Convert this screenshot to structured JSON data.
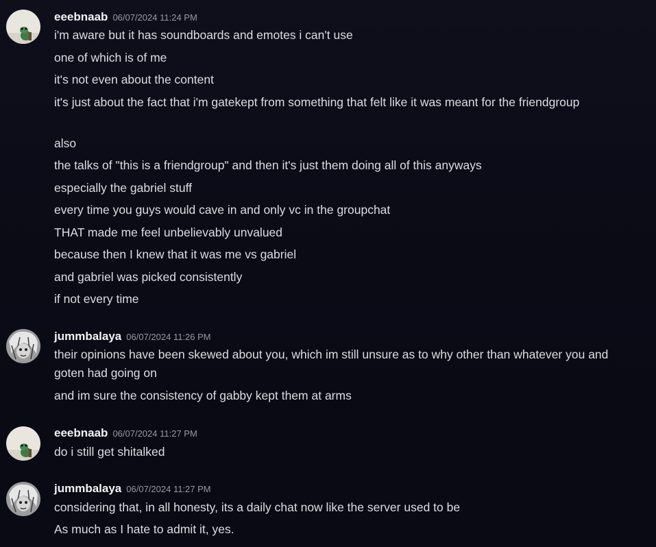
{
  "groups": [
    {
      "username": "eeebnaab",
      "timestamp": "06/07/2024 11:24 PM",
      "avatar_icon": "frog-avatar-icon",
      "messages": [
        "i'm aware but it has soundboards and emotes i can't use",
        "one of which is of me",
        "it's not even about the content",
        "it's just about the fact that i'm gatekept from something that felt like it was meant for the friendgroup",
        "also",
        "the talks of \"this is a friendgroup\" and then it's just them doing all of this anyways",
        "especially the gabriel stuff",
        "every time you guys would cave in and only vc in the groupchat",
        "THAT made me feel unbelievably unvalued",
        "because then I knew that it was me vs gabriel",
        "and gabriel was picked consistently",
        "if not every time"
      ]
    },
    {
      "username": "jummbalaya",
      "timestamp": "06/07/2024 11:26 PM",
      "avatar_icon": "manga-character-avatar-icon",
      "messages": [
        "their opinions have been skewed about you, which im still unsure as to why other than whatever you and goten had going on",
        "and im sure the consistency of gabby kept them at arms"
      ]
    },
    {
      "username": "eeebnaab",
      "timestamp": "06/07/2024 11:27 PM",
      "avatar_icon": "frog-avatar-icon",
      "messages": [
        "do i still get shitalked"
      ]
    },
    {
      "username": "jummbalaya",
      "timestamp": "06/07/2024 11:27 PM",
      "avatar_icon": "manga-character-avatar-icon",
      "messages": [
        "considering that, in all honesty, its a daily chat now like the server used to be",
        "As much as I hate to admit it, yes."
      ]
    }
  ],
  "colors": {
    "background": "#0c0c18",
    "username": "#f2f3f5",
    "timestamp": "#949ba4",
    "message_text": "#dbdee1"
  }
}
